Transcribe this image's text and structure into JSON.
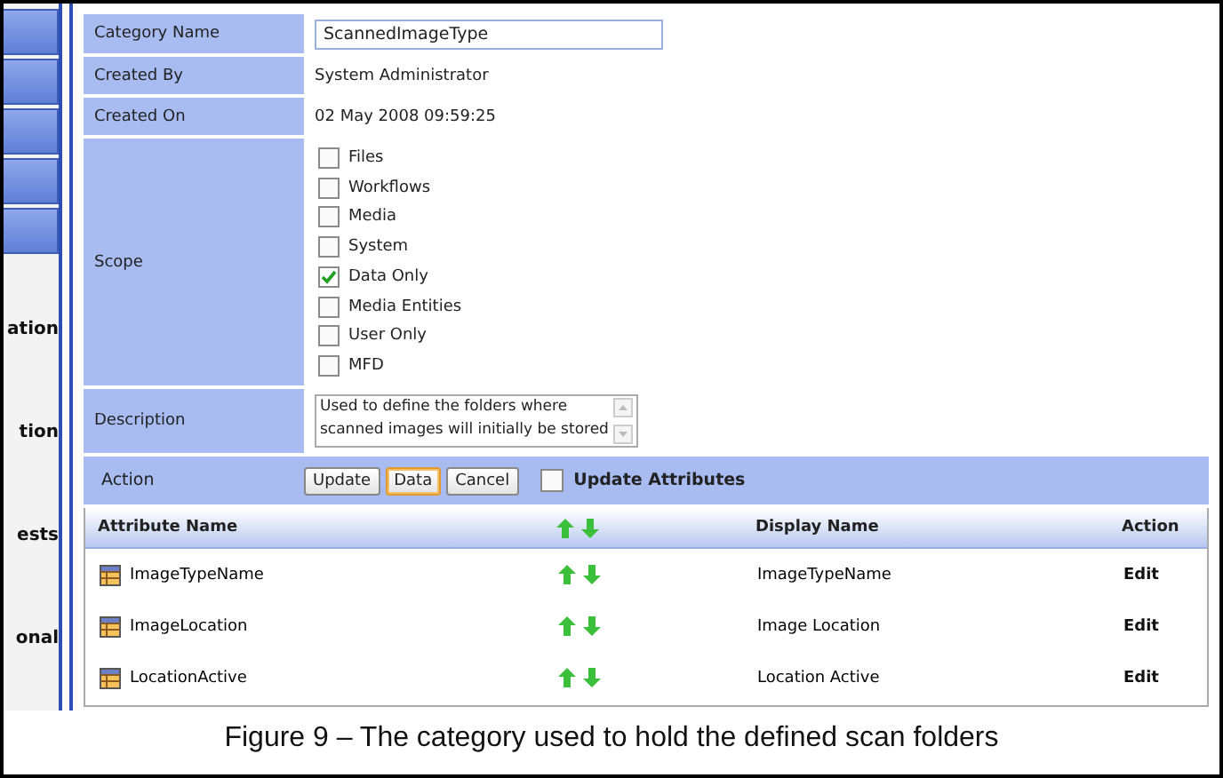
{
  "sidebar": {
    "labels": [
      "ation",
      "tion",
      "ests",
      "onal"
    ]
  },
  "fields": [
    {
      "kind": "input",
      "label": "Category Name",
      "value": "ScannedImageType"
    },
    {
      "kind": "text",
      "label": "Created By",
      "value": "System Administrator"
    },
    {
      "kind": "text",
      "label": "Created On",
      "value": "02 May 2008 09:59:25"
    },
    {
      "kind": "checklist",
      "label": "Scope",
      "options": [
        {
          "label": "Files",
          "checked": false
        },
        {
          "label": "Workflows",
          "checked": false
        },
        {
          "label": "Media",
          "checked": false
        },
        {
          "label": "System",
          "checked": false
        },
        {
          "label": "Data Only",
          "checked": true
        },
        {
          "label": "Media Entities",
          "checked": false
        },
        {
          "label": "User Only",
          "checked": false
        },
        {
          "label": "MFD",
          "checked": false
        }
      ]
    },
    {
      "kind": "textarea",
      "label": "Description",
      "lines": [
        "Used to define the folders where",
        "scanned images will initially be stored"
      ]
    }
  ],
  "action": {
    "label": "Action",
    "buttons": [
      {
        "label": "Update",
        "focused": false
      },
      {
        "label": "Data",
        "focused": true
      },
      {
        "label": "Cancel",
        "focused": false
      }
    ],
    "update_attributes": {
      "label": "Update Attributes",
      "checked": false
    }
  },
  "attributes": {
    "columns": [
      "Attribute Name",
      "Display Name",
      "Action"
    ],
    "rows": [
      {
        "name": "ImageTypeName",
        "display_name": "ImageTypeName",
        "action": "Edit"
      },
      {
        "name": "ImageLocation",
        "display_name": "Image Location",
        "action": "Edit"
      },
      {
        "name": "LocationActive",
        "display_name": "Location Active",
        "action": "Edit"
      }
    ]
  },
  "caption": "Figure 9 – The category used to hold the defined scan folders"
}
